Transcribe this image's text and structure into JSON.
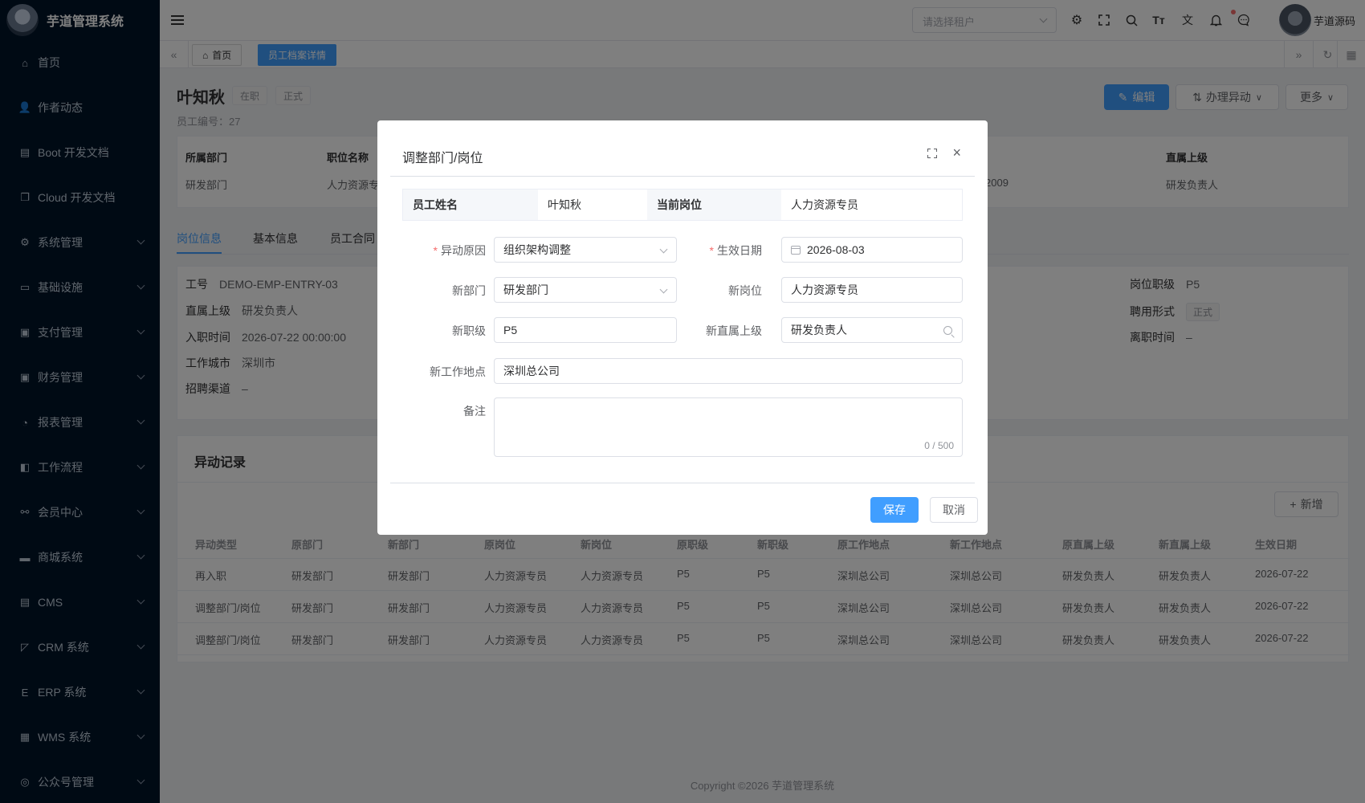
{
  "app": {
    "title": "芋道管理系统"
  },
  "sidebar": {
    "items": [
      {
        "label": "首页",
        "icon": "home-icon",
        "glyph": "⌂",
        "expandable": false
      },
      {
        "label": "作者动态",
        "icon": "user-icon",
        "glyph": "👤",
        "expandable": false
      },
      {
        "label": "Boot 开发文档",
        "icon": "document-icon",
        "glyph": "▤",
        "expandable": false
      },
      {
        "label": "Cloud 开发文档",
        "icon": "document-copy-icon",
        "glyph": "❐",
        "expandable": false
      },
      {
        "label": "系统管理",
        "icon": "gear-icon",
        "glyph": "⚙",
        "expandable": true
      },
      {
        "label": "基础设施",
        "icon": "monitor-icon",
        "glyph": "▭",
        "expandable": true
      },
      {
        "label": "支付管理",
        "icon": "wallet-icon",
        "glyph": "▣",
        "expandable": true
      },
      {
        "label": "财务管理",
        "icon": "wallet-icon",
        "glyph": "▣",
        "expandable": true
      },
      {
        "label": "报表管理",
        "icon": "chart-icon",
        "glyph": "◔",
        "expandable": true
      },
      {
        "label": "工作流程",
        "icon": "workflow-icon",
        "glyph": "◧",
        "expandable": true
      },
      {
        "label": "会员中心",
        "icon": "bicycle-icon",
        "glyph": "⚯",
        "expandable": true
      },
      {
        "label": "商城系统",
        "icon": "shop-icon",
        "glyph": "▬",
        "expandable": true
      },
      {
        "label": "CMS",
        "icon": "document-icon",
        "glyph": "▤",
        "expandable": true
      },
      {
        "label": "CRM 系统",
        "icon": "crm-icon",
        "glyph": "◸",
        "expandable": true
      },
      {
        "label": "ERP 系统",
        "icon": "erp-icon",
        "glyph": "E",
        "expandable": true
      },
      {
        "label": "WMS 系统",
        "icon": "box-icon",
        "glyph": "▦",
        "expandable": true
      },
      {
        "label": "公众号管理",
        "icon": "wechat-icon",
        "glyph": "◎",
        "expandable": true
      }
    ]
  },
  "header": {
    "tenant_placeholder": "请选择租户",
    "username": "芋道源码"
  },
  "tabs": {
    "home": "首页",
    "active": "员工档案详情"
  },
  "employee": {
    "name": "叶知秋",
    "status_tags": [
      "在职",
      "正式"
    ],
    "number_label": "员工编号：",
    "number": "27",
    "buttons": {
      "edit": "编辑",
      "transfer": "办理异动",
      "more": "更多"
    }
  },
  "summary": {
    "dept_label": "所属部门",
    "dept_value": "研发部门",
    "position_label": "职位名称",
    "position_value": "人力资源专员",
    "partial_value": "2009",
    "manager_label": "直属上级",
    "manager_value": "研发负责人"
  },
  "subtabs": [
    "岗位信息",
    "基本信息",
    "员工合同"
  ],
  "position_info": {
    "left": [
      {
        "k": "工号",
        "v": "DEMO-EMP-ENTRY-03"
      },
      {
        "k": "直属上级",
        "v": "研发负责人"
      },
      {
        "k": "入职时间",
        "v": "2026-07-22 00:00:00"
      },
      {
        "k": "工作城市",
        "v": "深圳市"
      },
      {
        "k": "招聘渠道",
        "v": "–"
      }
    ],
    "right": [
      {
        "k": "岗位职级",
        "v": "P5"
      },
      {
        "k": "聘用形式",
        "v": "正式"
      },
      {
        "k": "离职时间",
        "v": "–"
      }
    ]
  },
  "records": {
    "title": "异动记录",
    "add_button": "新增",
    "headers": [
      "异动类型",
      "原部门",
      "新部门",
      "原岗位",
      "新岗位",
      "原职级",
      "新职级",
      "原工作地点",
      "新工作地点",
      "原直属上级",
      "新直属上级",
      "生效日期"
    ],
    "rows": [
      [
        "再入职",
        "研发部门",
        "研发部门",
        "人力资源专员",
        "人力资源专员",
        "P5",
        "P5",
        "深圳总公司",
        "深圳总公司",
        "研发负责人",
        "研发负责人",
        "2026-07-22"
      ],
      [
        "调整部门/岗位",
        "研发部门",
        "研发部门",
        "人力资源专员",
        "人力资源专员",
        "P5",
        "P5",
        "深圳总公司",
        "深圳总公司",
        "研发负责人",
        "研发负责人",
        "2026-07-22"
      ],
      [
        "调整部门/岗位",
        "研发部门",
        "研发部门",
        "人力资源专员",
        "人力资源专员",
        "P5",
        "P5",
        "深圳总公司",
        "深圳总公司",
        "研发负责人",
        "研发负责人",
        "2026-07-22"
      ]
    ]
  },
  "footer": "Copyright ©2026 芋道管理系统",
  "dialog": {
    "title": "调整部门/岗位",
    "info": {
      "name_label": "员工姓名",
      "name_value": "叶知秋",
      "position_label": "当前岗位",
      "position_value": "人力资源专员"
    },
    "form": {
      "reason_label": "异动原因",
      "reason_value": "组织架构调整",
      "date_label": "生效日期",
      "date_value": "2026-08-03",
      "dept_label": "新部门",
      "dept_value": "研发部门",
      "position_label": "新岗位",
      "position_value": "人力资源专员",
      "level_label": "新职级",
      "level_value": "P5",
      "manager_label": "新直属上级",
      "manager_value": "研发负责人",
      "location_label": "新工作地点",
      "location_value": "深圳总公司",
      "remark_label": "备注",
      "remark_counter": "0 / 500"
    },
    "save": "保存",
    "cancel": "取消"
  },
  "colors": {
    "primary": "#409eff",
    "sidebar_bg": "#001529",
    "danger": "#f56c6c"
  }
}
